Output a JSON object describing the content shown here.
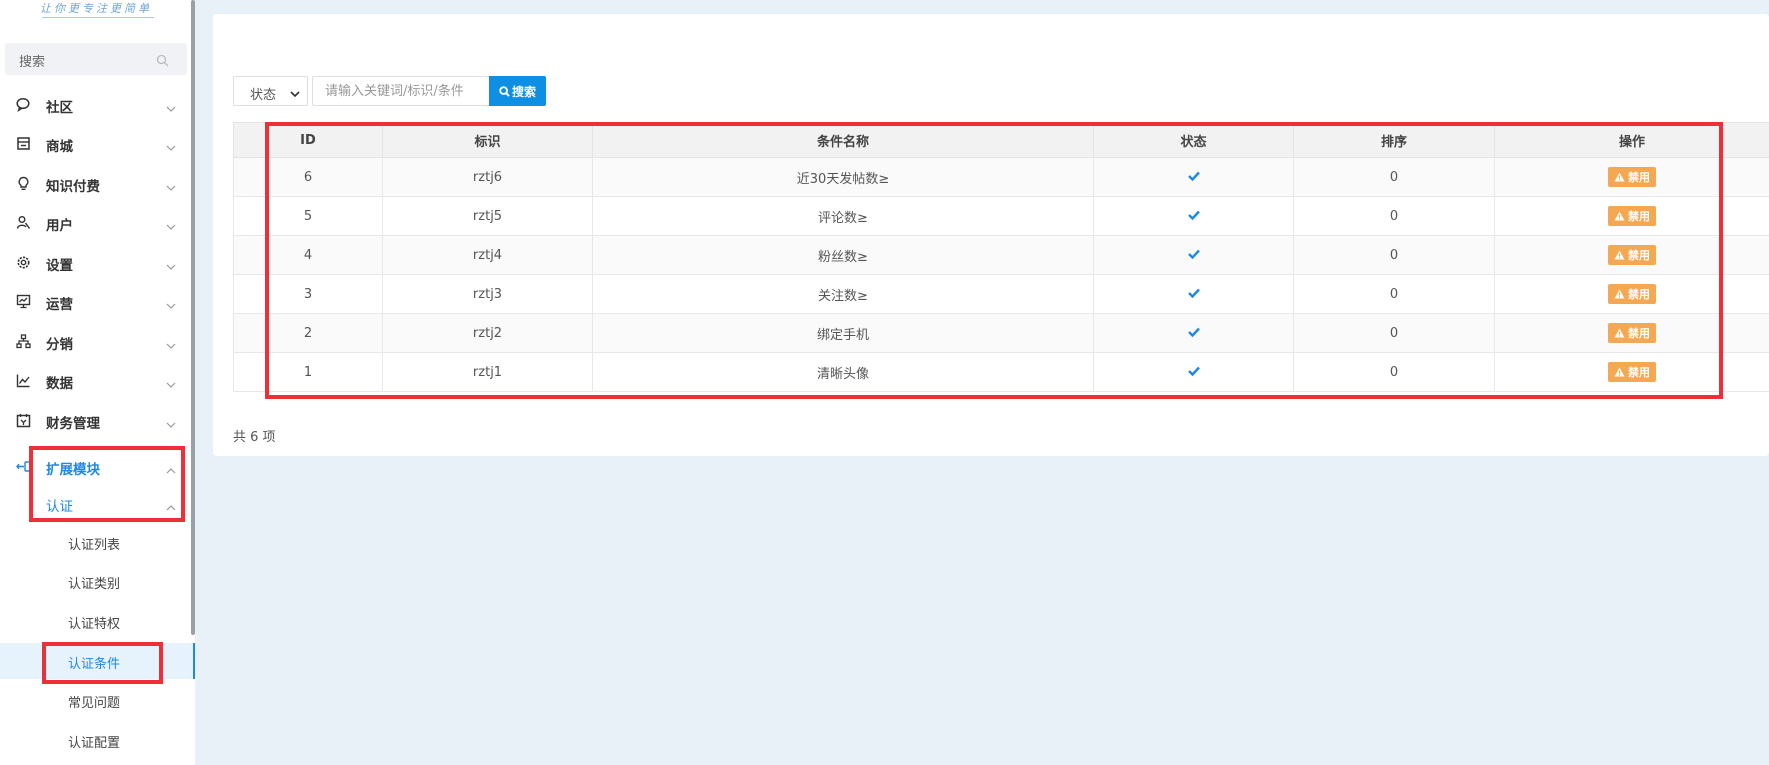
{
  "sidebar": {
    "logo_text": "让你更专注更简单",
    "search_placeholder": "搜索",
    "menu": [
      {
        "label": "社区",
        "icon": "chat-icon"
      },
      {
        "label": "商城",
        "icon": "shop-icon"
      },
      {
        "label": "知识付费",
        "icon": "lightbulb-icon"
      },
      {
        "label": "用户",
        "icon": "user-icon"
      },
      {
        "label": "设置",
        "icon": "gear-icon"
      },
      {
        "label": "运营",
        "icon": "monitor-chart-icon"
      },
      {
        "label": "分销",
        "icon": "hierarchy-icon"
      },
      {
        "label": "数据",
        "icon": "line-chart-icon"
      },
      {
        "label": "财务管理",
        "icon": "finance-calendar-icon"
      }
    ],
    "active_module": {
      "label": "扩展模块",
      "icon": "extension-icon"
    },
    "active_group": {
      "label": "认证"
    },
    "sub_items": [
      "认证列表",
      "认证类别",
      "认证特权",
      "认证条件",
      "常见问题",
      "认证配置"
    ],
    "selected_sub_item": "认证条件"
  },
  "toolbar": {
    "status_select": "状态",
    "keyword_placeholder": "请输入关键词/标识/条件",
    "search_button": "搜索"
  },
  "table": {
    "headers": [
      "ID",
      "标识",
      "条件名称",
      "状态",
      "排序",
      "操作"
    ],
    "rows": [
      {
        "id": "6",
        "key": "rztj6",
        "name": "近30天发帖数≥",
        "enabled": true,
        "sort": "0",
        "action": "禁用"
      },
      {
        "id": "5",
        "key": "rztj5",
        "name": "评论数≥",
        "enabled": true,
        "sort": "0",
        "action": "禁用"
      },
      {
        "id": "4",
        "key": "rztj4",
        "name": "粉丝数≥",
        "enabled": true,
        "sort": "0",
        "action": "禁用"
      },
      {
        "id": "3",
        "key": "rztj3",
        "name": "关注数≥",
        "enabled": true,
        "sort": "0",
        "action": "禁用"
      },
      {
        "id": "2",
        "key": "rztj2",
        "name": "绑定手机",
        "enabled": true,
        "sort": "0",
        "action": "禁用"
      },
      {
        "id": "1",
        "key": "rztj1",
        "name": "清晰头像",
        "enabled": true,
        "sort": "0",
        "action": "禁用"
      }
    ]
  },
  "footer": {
    "total_text": "共 6 项"
  },
  "colors": {
    "accent": "#1e88e5",
    "ban_button": "#f5a852",
    "highlight": "#ee2f37"
  }
}
